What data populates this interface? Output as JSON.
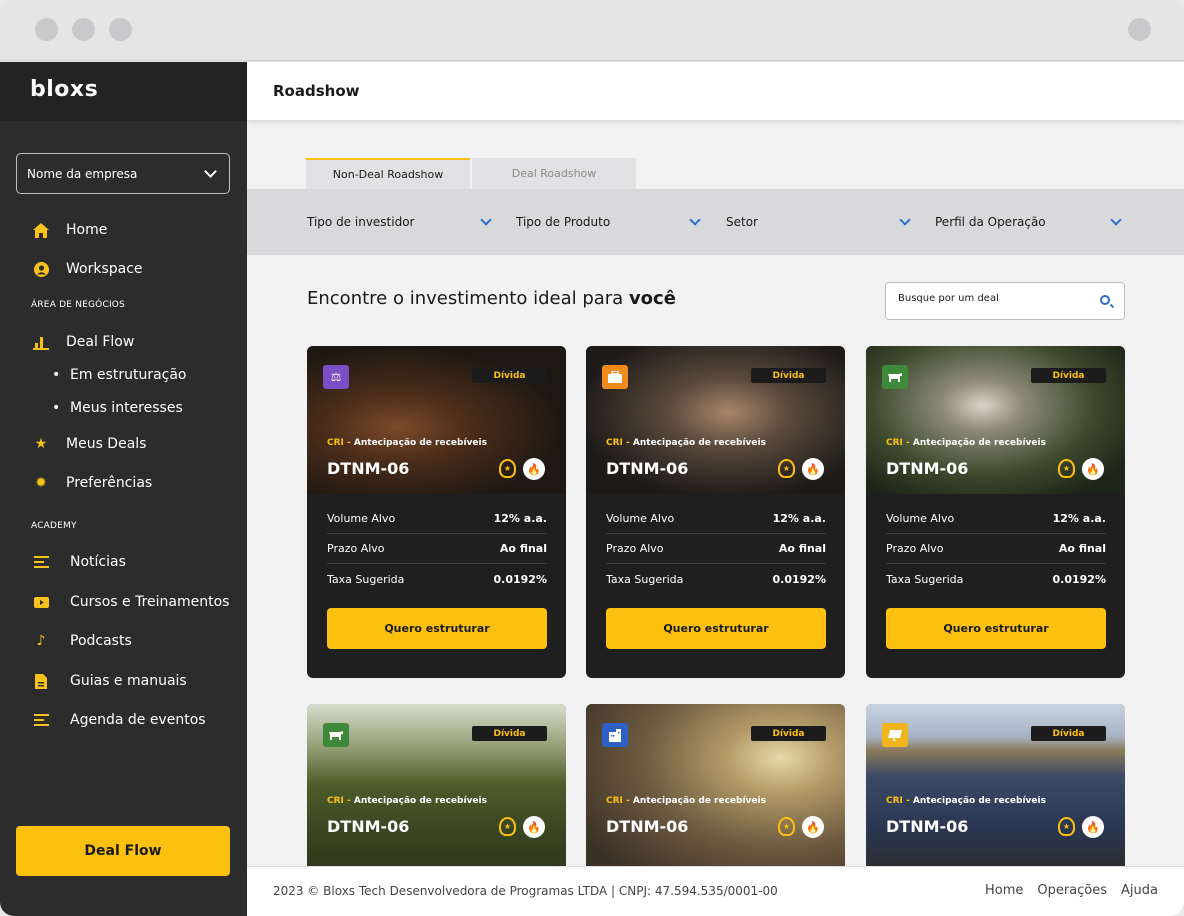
{
  "sidebar": {
    "logo": "bloxs",
    "company_select": "Nome da empresa",
    "items": [
      {
        "label": "Home",
        "icon": "home-icon"
      },
      {
        "label": "Workspace",
        "icon": "user-icon"
      }
    ],
    "section_business": "ÁREA DE NEGÓCIOS",
    "deal_flow": "Deal Flow",
    "sub_items": [
      "Em estruturação",
      "Meus interesses"
    ],
    "meus_deals": "Meus Deals",
    "preferencias": "Preferências",
    "section_academy": "ACADEMY",
    "academy": [
      "Notícias",
      "Cursos e Treinamentos",
      "Podcasts",
      "Guias e manuais",
      "Agenda de eventos"
    ],
    "cta": "Deal Flow"
  },
  "topbar": {
    "title": "Roadshow"
  },
  "tabs": [
    "Non-Deal Roadshow",
    "Deal Roadshow"
  ],
  "filters": [
    "Tipo de investidor",
    "Tipo de Produto",
    "Setor",
    "Perfil da Operação"
  ],
  "headline": {
    "prefix": "Encontre o investimento ideal para",
    "bold": "você"
  },
  "search": {
    "placeholder": "Busque por um deal"
  },
  "cards": [
    {
      "pill": "Dívida",
      "type_hl": "CRI -",
      "type": "Antecipação de recebíveis",
      "code": "DTNM-06",
      "rows": [
        {
          "k": "Volume Alvo",
          "v": "12% a.a."
        },
        {
          "k": "Prazo Alvo",
          "v": "Ao final"
        },
        {
          "k": "Taxa Sugerida",
          "v": "0.0192%"
        }
      ],
      "cta": "Quero estruturar"
    },
    {
      "pill": "Dívida",
      "type_hl": "CRI -",
      "type": "Antecipação de recebíveis",
      "code": "DTNM-06",
      "rows": [
        {
          "k": "Volume Alvo",
          "v": "12% a.a."
        },
        {
          "k": "Prazo Alvo",
          "v": "Ao final"
        },
        {
          "k": "Taxa Sugerida",
          "v": "0.0192%"
        }
      ],
      "cta": "Quero estruturar"
    },
    {
      "pill": "Dívida",
      "type_hl": "CRI -",
      "type": "Antecipação de recebíveis",
      "code": "DTNM-06",
      "rows": [
        {
          "k": "Volume Alvo",
          "v": "12% a.a."
        },
        {
          "k": "Prazo Alvo",
          "v": "Ao final"
        },
        {
          "k": "Taxa Sugerida",
          "v": "0.0192%"
        }
      ],
      "cta": "Quero estruturar"
    },
    {
      "pill": "Dívida",
      "type_hl": "CRI -",
      "type": "Antecipação de recebíveis",
      "code": "DTNM-06"
    },
    {
      "pill": "Dívida",
      "type_hl": "CRI -",
      "type": "Antecipação de recebíveis",
      "code": "DTNM-06"
    },
    {
      "pill": "Dívida",
      "type_hl": "CRI -",
      "type": "Antecipação de recebíveis",
      "code": "DTNM-06"
    }
  ],
  "footer": {
    "copyright": "2023 © Bloxs Tech Desenvolvedora de Programas LTDA | CNPJ: 47.594.535/0001-00",
    "links": [
      "Home",
      "Operações",
      "Ajuda"
    ]
  },
  "colors": {
    "accent": "#fcc00e",
    "sidebar": "#2c2c2c",
    "link": "#2b6fc8"
  }
}
